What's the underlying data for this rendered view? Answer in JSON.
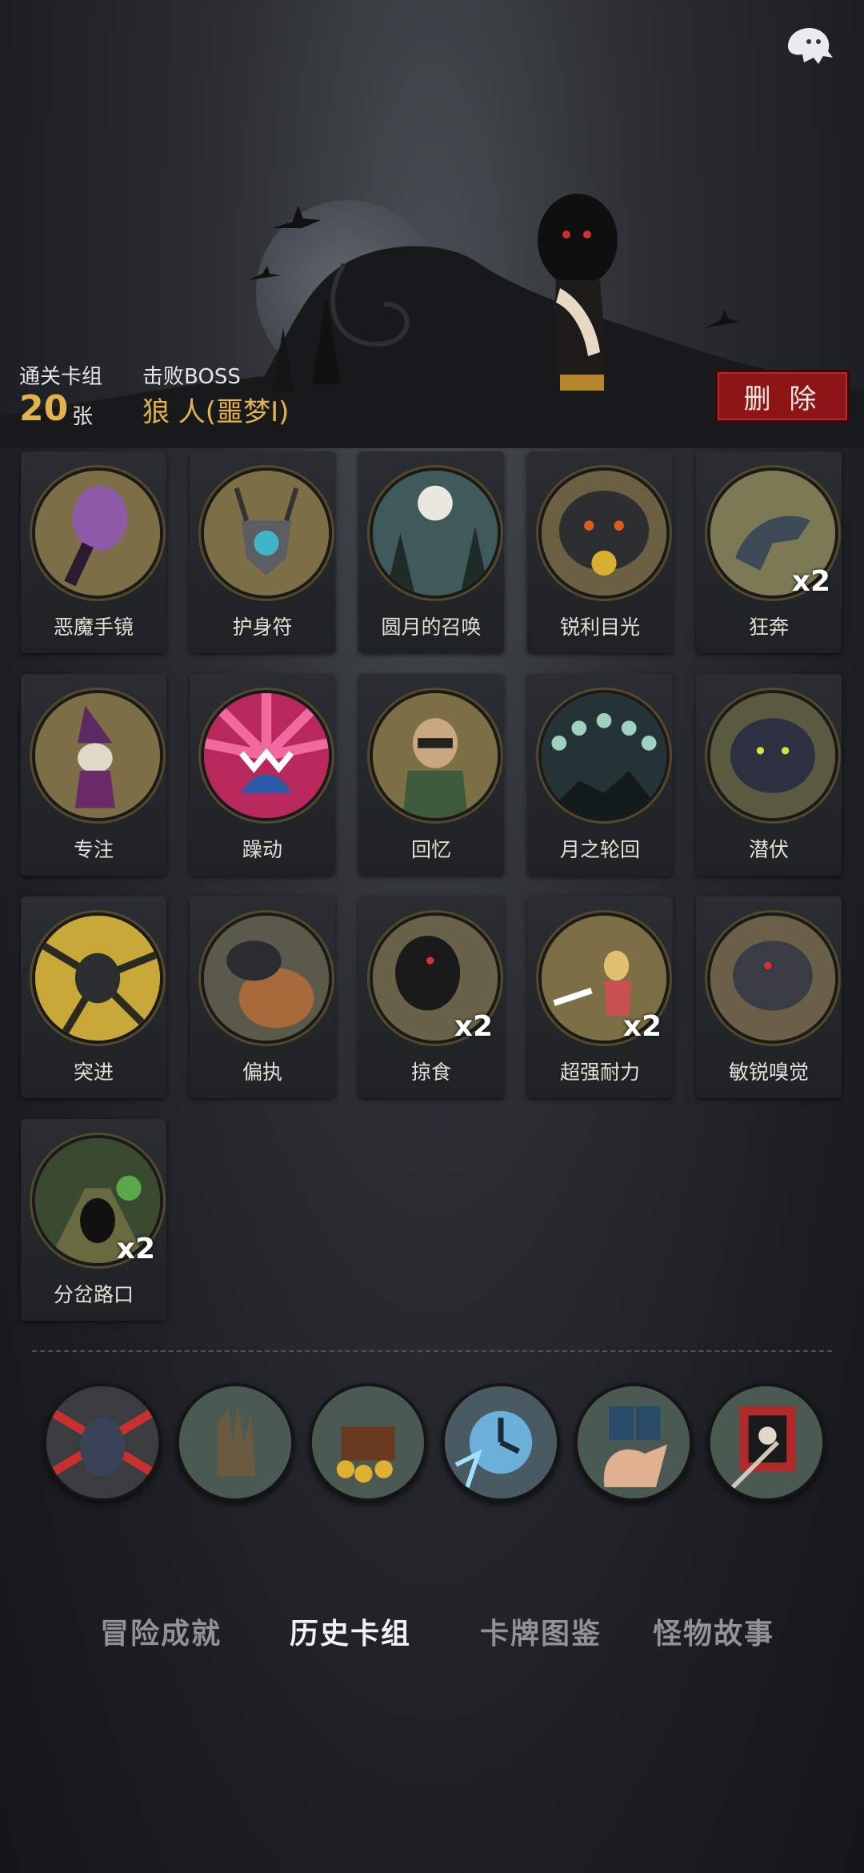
{
  "header": {
    "cards_label": "通关卡组",
    "cards_value": "20",
    "cards_unit": "张",
    "boss_label": "击败BOSS",
    "boss_name": "狼 人(噩梦I)",
    "delete_label": "删 除"
  },
  "cards": [
    {
      "label": "恶魔手镜",
      "icon": "demon-mirror-icon",
      "count": ""
    },
    {
      "label": "护身符",
      "icon": "amulet-icon",
      "count": ""
    },
    {
      "label": "圆月的召唤",
      "icon": "full-moon-icon",
      "count": ""
    },
    {
      "label": "锐利目光",
      "icon": "wolf-gaze-icon",
      "count": ""
    },
    {
      "label": "狂奔",
      "icon": "running-wolf-icon",
      "count": "x2"
    },
    {
      "label": "专注",
      "icon": "wizard-icon",
      "count": ""
    },
    {
      "label": "躁动",
      "icon": "restless-icon",
      "count": ""
    },
    {
      "label": "回忆",
      "icon": "old-man-icon",
      "count": ""
    },
    {
      "label": "月之轮回",
      "icon": "moon-phases-icon",
      "count": ""
    },
    {
      "label": "潜伏",
      "icon": "lurking-wolf-icon",
      "count": ""
    },
    {
      "label": "突进",
      "icon": "lunge-icon",
      "count": ""
    },
    {
      "label": "偏执",
      "icon": "wolf-bear-icon",
      "count": ""
    },
    {
      "label": "掠食",
      "icon": "predator-icon",
      "count": "x2"
    },
    {
      "label": "超强耐力",
      "icon": "endurance-icon",
      "count": "x2"
    },
    {
      "label": "敏锐嗅觉",
      "icon": "keen-smell-icon",
      "count": ""
    },
    {
      "label": "分岔路口",
      "icon": "crossroad-icon",
      "count": "x2"
    }
  ],
  "relics": [
    {
      "icon": "werewolf-relic-icon"
    },
    {
      "icon": "hand-statue-relic-icon"
    },
    {
      "icon": "treasure-chest-relic-icon"
    },
    {
      "icon": "clock-relic-icon"
    },
    {
      "icon": "hand-cards-relic-icon"
    },
    {
      "icon": "pirate-flag-relic-icon"
    }
  ],
  "tabs": [
    {
      "label": "冒险成就",
      "active": false
    },
    {
      "label": "历史卡组",
      "active": true
    },
    {
      "label": "卡牌图鉴",
      "active": false
    },
    {
      "label": "怪物故事",
      "active": false
    }
  ],
  "colors": {
    "accent": "#e3b24e",
    "delete": "#8d1516",
    "disc": "#7c6f45"
  }
}
